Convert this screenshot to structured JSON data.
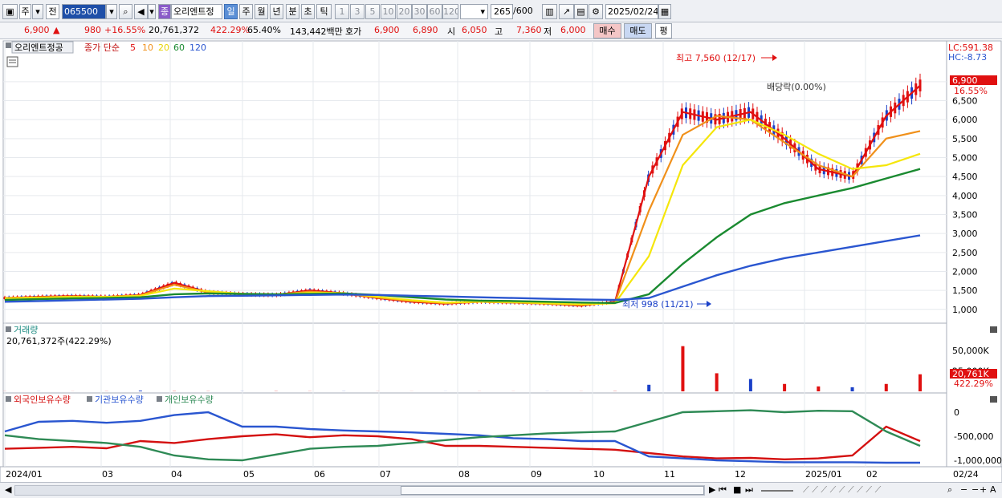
{
  "toolbar": {
    "market": "주",
    "prev": "전",
    "code": "065500",
    "badge": "종",
    "name": "오리엔트정",
    "periods": [
      "일",
      "주",
      "월",
      "년",
      "분",
      "초",
      "틱"
    ],
    "intervals": [
      "1",
      "3",
      "5",
      "10",
      "20",
      "30",
      "60",
      "120"
    ],
    "count": "265",
    "count_total": "/600",
    "date": "2025/02/24"
  },
  "quote": {
    "price": "6,900",
    "change": "980",
    "change_pct": "+16.55%",
    "volume": "20,761,372",
    "volume_pct": "422.29%",
    "ratio": "65.40%",
    "amount": "143,442백만",
    "bid_label": "호가",
    "ask": "6,900",
    "bid": "6,890",
    "open_label": "시",
    "open": "6,050",
    "high_label": "고",
    "high": "7,360",
    "low_label": "저",
    "low": "6,000",
    "buy": "매수",
    "sell": "매도",
    "avg": "평"
  },
  "price_panel": {
    "stock_label": "오리엔트정공",
    "ma_title": "종가 단순",
    "ma_periods": [
      "5",
      "10",
      "20",
      "60",
      "120"
    ],
    "lc": "LC:591.38",
    "hc": "HC:-8.73",
    "high_ann": "최고 7,560 (12/17)",
    "low_ann": "최저 998 (11/21)",
    "dividend": "배당락(0.00%)",
    "last_price": "6,900",
    "last_pct": "16.55%"
  },
  "volume_panel": {
    "title": "거래량",
    "value": "20,761,372주(422.29%)",
    "last_label": "20,761K",
    "last_pct": "422.29%"
  },
  "holding_panel": {
    "titles": [
      "외국인보유수량",
      "기관보유수량",
      "개인보유수량"
    ]
  },
  "x_axis_labels": [
    "2024/01",
    "03",
    "04",
    "05",
    "06",
    "07",
    "08",
    "09",
    "10",
    "11",
    "12",
    "2025/01",
    "02",
    "02/24"
  ],
  "colors": {
    "ma5": "#e01010",
    "ma10": "#f0901a",
    "ma20": "#f5e60a",
    "ma60": "#1a8a30",
    "ma120": "#2a56d0",
    "up": "#e01010",
    "down": "#1a40c8",
    "foreign": "#d41010",
    "inst": "#2a56d0",
    "retail": "#2e8a55"
  },
  "chart_data": [
    {
      "type": "line",
      "title": "오리엔트정공",
      "series_note": "price with moving averages",
      "y_ticks": [
        1000,
        1500,
        2000,
        2500,
        3000,
        3500,
        4000,
        4500,
        5000,
        5500,
        6000,
        6500,
        7000
      ],
      "ylim": [
        700,
        7800
      ],
      "x_months": [
        "2024/01",
        "03",
        "04",
        "05",
        "06",
        "07",
        "08",
        "09",
        "10",
        "11",
        "12",
        "2025/01",
        "02"
      ],
      "series": [
        {
          "name": "5",
          "values": [
            1300,
            1330,
            1350,
            1330,
            1380,
            1700,
            1450,
            1400,
            1380,
            1500,
            1420,
            1300,
            1200,
            1150,
            1200,
            1180,
            1150,
            1100,
            1200,
            4500,
            6200,
            6000,
            6200,
            5500,
            4700,
            4500,
            6100,
            6900
          ]
        },
        {
          "name": "10",
          "values": [
            1300,
            1320,
            1340,
            1330,
            1370,
            1650,
            1450,
            1400,
            1390,
            1470,
            1420,
            1310,
            1220,
            1160,
            1200,
            1180,
            1150,
            1120,
            1180,
            3600,
            5600,
            6100,
            6000,
            5400,
            4800,
            4500,
            5500,
            5700
          ]
        },
        {
          "name": "20",
          "values": [
            1290,
            1310,
            1330,
            1330,
            1360,
            1550,
            1480,
            1410,
            1390,
            1440,
            1430,
            1330,
            1240,
            1180,
            1200,
            1190,
            1160,
            1130,
            1160,
            2400,
            4800,
            5800,
            6000,
            5600,
            5100,
            4700,
            4800,
            5100
          ]
        },
        {
          "name": "60",
          "values": [
            1250,
            1270,
            1290,
            1300,
            1320,
            1400,
            1420,
            1410,
            1400,
            1410,
            1420,
            1380,
            1320,
            1260,
            1230,
            1220,
            1200,
            1180,
            1170,
            1400,
            2200,
            2900,
            3500,
            3800,
            4000,
            4200,
            4450,
            4700
          ]
        },
        {
          "name": "120",
          "values": [
            1200,
            1220,
            1240,
            1260,
            1280,
            1320,
            1350,
            1360,
            1370,
            1380,
            1390,
            1380,
            1360,
            1340,
            1320,
            1300,
            1280,
            1260,
            1250,
            1300,
            1600,
            1900,
            2150,
            2350,
            2500,
            2650,
            2800,
            2950
          ]
        }
      ]
    },
    {
      "type": "bar",
      "title": "거래량",
      "y_ticks": [
        50000,
        25000
      ],
      "y_unit": "K",
      "values": [
        120,
        150,
        100,
        180,
        900,
        300,
        200,
        150,
        250,
        180,
        160,
        120,
        100,
        90,
        110,
        100,
        95,
        120,
        250,
        8000,
        55000,
        22000,
        15000,
        9000,
        6000,
        5000,
        9000,
        20761
      ]
    },
    {
      "type": "line",
      "title": "외국인보유수량 / 기관보유수량 / 개인보유수량",
      "y_ticks": [
        0,
        -500000,
        -1000000
      ],
      "series": [
        {
          "name": "외국인보유수량",
          "values": [
            -760000,
            -740000,
            -720000,
            -750000,
            -600000,
            -640000,
            -560000,
            -500000,
            -460000,
            -520000,
            -480000,
            -500000,
            -560000,
            -700000,
            -700000,
            -720000,
            -740000,
            -760000,
            -780000,
            -850000,
            -920000,
            -960000,
            -950000,
            -980000,
            -960000,
            -900000,
            -300000,
            -600000
          ]
        },
        {
          "name": "기관보유수량",
          "values": [
            -400000,
            -200000,
            -180000,
            -220000,
            -180000,
            -60000,
            0,
            -300000,
            -300000,
            -350000,
            -380000,
            -400000,
            -420000,
            -450000,
            -480000,
            -540000,
            -560000,
            -600000,
            -600000,
            -920000,
            -960000,
            -1000000,
            -1020000,
            -1040000,
            -1040000,
            -1040000,
            -1050000,
            -1050000
          ]
        },
        {
          "name": "개인보유수량",
          "values": [
            -480000,
            -560000,
            -600000,
            -640000,
            -720000,
            -900000,
            -980000,
            -1000000,
            -880000,
            -760000,
            -720000,
            -700000,
            -640000,
            -580000,
            -520000,
            -480000,
            -440000,
            -420000,
            -400000,
            -200000,
            0,
            20000,
            40000,
            0,
            30000,
            20000,
            -400000,
            -700000
          ]
        }
      ]
    }
  ]
}
